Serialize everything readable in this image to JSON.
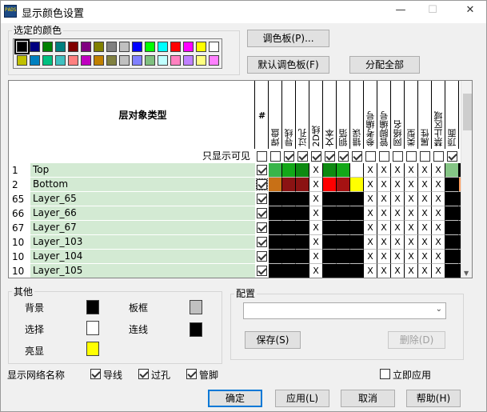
{
  "window": {
    "title": "显示颜色设置",
    "minimize": "—",
    "maximize": "☐",
    "close": "✕"
  },
  "selected_colors": {
    "label": "选定的颜色",
    "row1": [
      "#000000",
      "#000080",
      "#008000",
      "#008080",
      "#800000",
      "#800080",
      "#808000",
      "#808080",
      "#c0c0c0",
      "#0000ff",
      "#00ff00",
      "#00ffff",
      "#ff0000",
      "#ff00ff",
      "#ffff00",
      "#ffffff"
    ],
    "row2": [
      "#c0c000",
      "#0080c0",
      "#00c080",
      "#40c0c0",
      "#ff8080",
      "#c000c0",
      "#c08000",
      "#808040",
      "#c0c0c0",
      "#8080ff",
      "#80c080",
      "#c0ffff",
      "#ff80c0",
      "#c080ff",
      "#ffff80",
      "#ff80ff"
    ]
  },
  "buttons": {
    "palette": "调色板(P)...",
    "default_palette": "默认调色板(F)",
    "assign_all": "分配全部",
    "save": "保存(S)",
    "delete": "删除(D)",
    "ok": "确定",
    "apply": "应用(L)",
    "cancel": "取消",
    "help": "帮助(H)"
  },
  "grid": {
    "layer_type_header": "层对象类型",
    "hash_header": "#",
    "columns": [
      "焊盘",
      "导线",
      "过孔",
      "2D线",
      "文本",
      "铜箔",
      "错误",
      "参考编号",
      "管脚编号",
      "网络名",
      "类型",
      "属性",
      "禁止区域",
      "顶面",
      "底面"
    ],
    "visible_only_label": "只显示可见",
    "top_checks": [
      false,
      true,
      true,
      true,
      true,
      true,
      true,
      false,
      false,
      false,
      false,
      false,
      false,
      true,
      true
    ],
    "rows": [
      {
        "num": "1",
        "name": "Top",
        "cells": [
          "#39b54a",
          "#13a818",
          "#0d8a11",
          "X",
          "#0d8a11",
          "#13a818",
          "",
          "X",
          "X",
          "X",
          "X",
          "X",
          "X",
          "#85c585",
          "#000000"
        ]
      },
      {
        "num": "2",
        "name": "Bottom",
        "cells": [
          "#c87016",
          "#8b1313",
          "#8b1313",
          "X",
          "#ff0000",
          "#a51212",
          "#ffff00",
          "X",
          "X",
          "X",
          "X",
          "X",
          "X",
          "#000000",
          "#ffa060"
        ]
      },
      {
        "num": "65",
        "name": "Layer_65",
        "cells": [
          "#000000",
          "#000000",
          "#000000",
          "X",
          "#000000",
          "#000000",
          "#000000",
          "X",
          "X",
          "X",
          "X",
          "X",
          "X",
          "#000000",
          "#000000"
        ]
      },
      {
        "num": "66",
        "name": "Layer_66",
        "cells": [
          "#000000",
          "#000000",
          "#000000",
          "X",
          "#000000",
          "#000000",
          "#000000",
          "X",
          "X",
          "X",
          "X",
          "X",
          "X",
          "#000000",
          "#000000"
        ]
      },
      {
        "num": "67",
        "name": "Layer_67",
        "cells": [
          "#000000",
          "#000000",
          "#000000",
          "X",
          "#000000",
          "#000000",
          "#000000",
          "X",
          "X",
          "X",
          "X",
          "X",
          "X",
          "#000000",
          "#000000"
        ]
      },
      {
        "num": "10",
        "name": "Layer_103",
        "cells": [
          "#000000",
          "#000000",
          "#000000",
          "X",
          "#000000",
          "#000000",
          "#000000",
          "X",
          "X",
          "X",
          "X",
          "X",
          "X",
          "#000000",
          "#000000"
        ]
      },
      {
        "num": "10",
        "name": "Layer_104",
        "cells": [
          "#000000",
          "#000000",
          "#000000",
          "X",
          "#000000",
          "#000000",
          "#000000",
          "X",
          "X",
          "X",
          "X",
          "X",
          "X",
          "#000000",
          "#000000"
        ]
      },
      {
        "num": "10",
        "name": "Layer_105",
        "cells": [
          "#000000",
          "#000000",
          "#000000",
          "X",
          "#000000",
          "#000000",
          "#000000",
          "X",
          "X",
          "X",
          "X",
          "X",
          "X",
          "#000000",
          "#000000"
        ]
      }
    ]
  },
  "other": {
    "label": "其他",
    "background_label": "背景",
    "background_color": "#000000",
    "board_frame_label": "板框",
    "board_frame_color": "#c0c0c0",
    "selection_label": "选择",
    "selection_color": "#ffffff",
    "connection_label": "连线",
    "connection_color": "#000000",
    "highlight_label": "亮显",
    "highlight_color": "#ffff00"
  },
  "config": {
    "label": "配置",
    "value": ""
  },
  "net_names": {
    "label": "显示网络名称",
    "trace": "导线",
    "via": "过孔",
    "pin": "管脚",
    "apply_now": "立即应用"
  }
}
